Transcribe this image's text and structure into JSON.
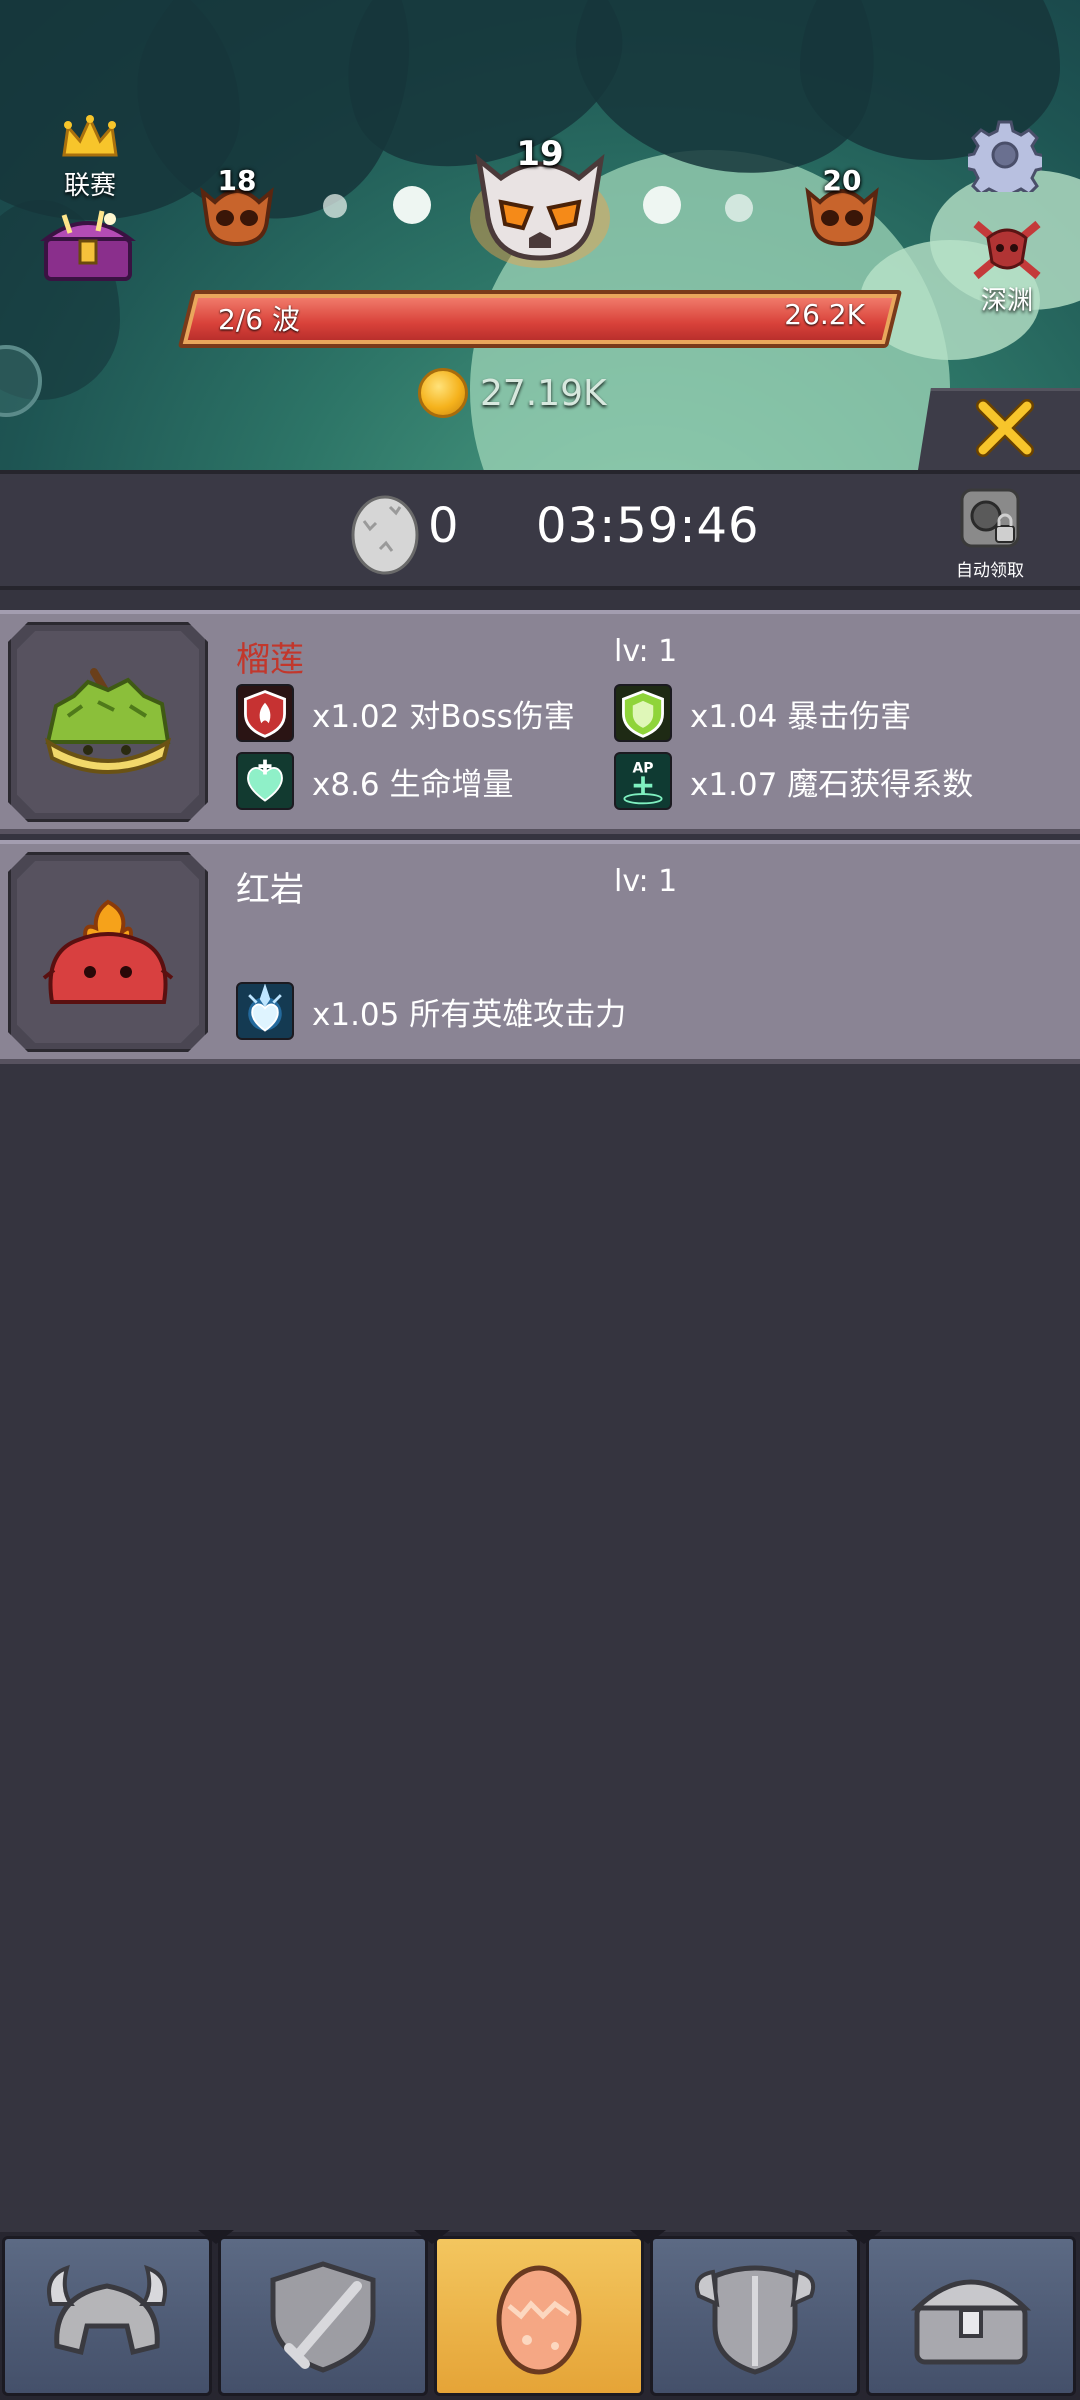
{
  "header": {
    "league_label": "联赛",
    "stages": {
      "prev": "18",
      "current": "19",
      "next": "20"
    },
    "abyss_label": "深渊",
    "wave_label": "2/6 波",
    "boss_hp": "26.2K",
    "wave_progress": 1.0,
    "gold": "27.19K"
  },
  "hatch": {
    "egg_count": "0",
    "timer": "03:59:46",
    "auto_claim_label": "自动领取"
  },
  "pets": [
    {
      "name": "榴莲",
      "name_color": "#c2372c",
      "level": "lv: 1",
      "stats": [
        {
          "icon": "fire-shield-icon",
          "text": "x1.02 对Boss伤害"
        },
        {
          "icon": "green-shield-icon",
          "text": "x1.04 暴击伤害"
        },
        {
          "icon": "heart-cross-icon",
          "text": "x8.6 生命增量"
        },
        {
          "icon": "ap-gem-icon",
          "text": "x1.07 魔石获得系数"
        }
      ]
    },
    {
      "name": "红岩",
      "name_color": "#ffffff",
      "level": "lv: 1",
      "stats": [
        {
          "icon": "hero-attack-icon",
          "text": "x1.05 所有英雄攻击力"
        }
      ]
    }
  ],
  "nav": {
    "items": [
      {
        "icon": "helmet-icon"
      },
      {
        "icon": "shield-sword-icon"
      },
      {
        "icon": "egg-icon",
        "active": true
      },
      {
        "icon": "armor-icon"
      },
      {
        "icon": "treasure-chest-icon"
      }
    ]
  }
}
